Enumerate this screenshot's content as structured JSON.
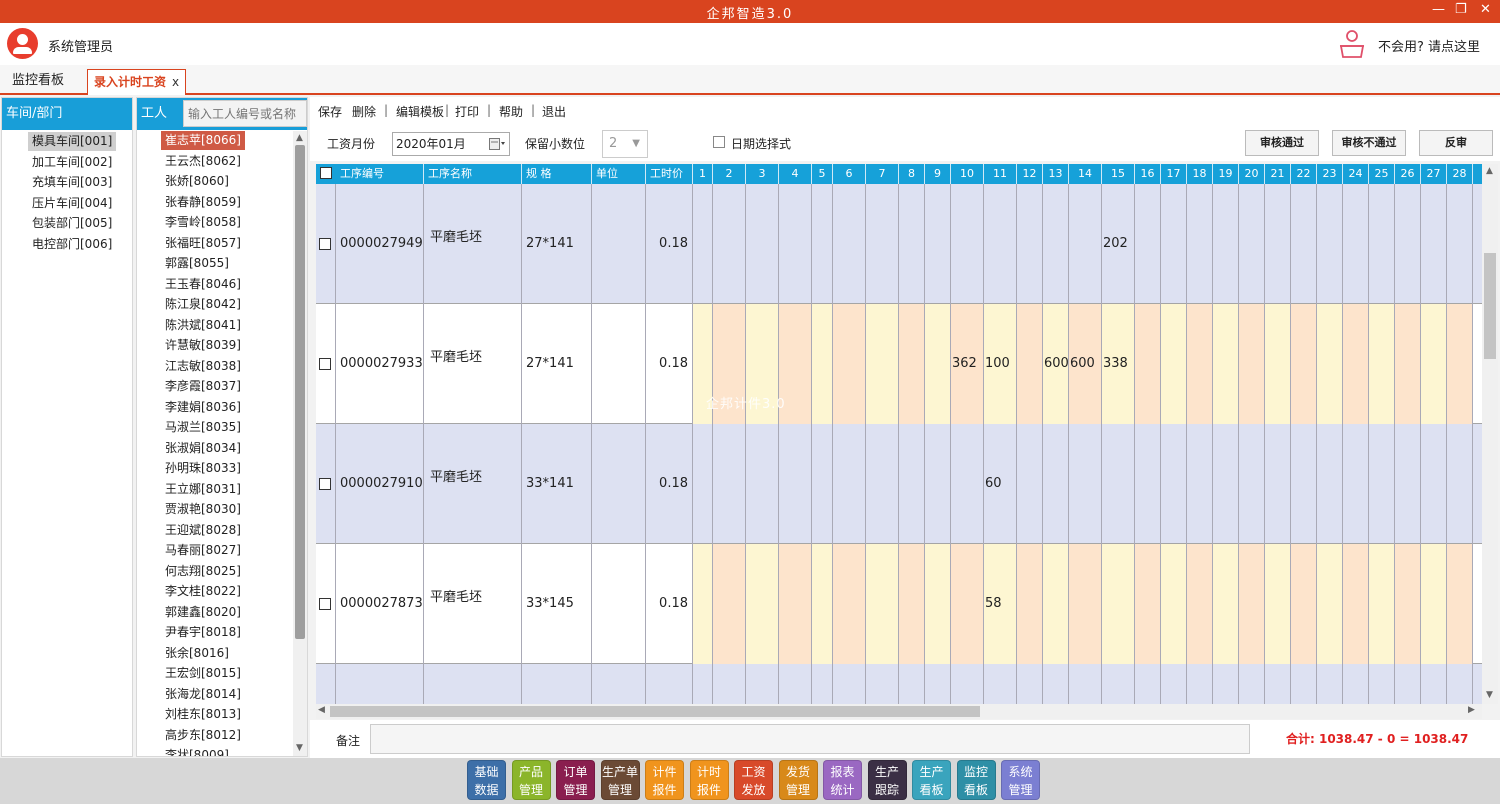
{
  "app": {
    "title": "企邦智造3.0"
  },
  "user": {
    "name": "系统管理员",
    "help_text": "不会用? 请点这里"
  },
  "tabs": [
    {
      "label": "监控看板"
    },
    {
      "label": "录入计时工资",
      "close": "x"
    }
  ],
  "departments": {
    "header": "车间/部门",
    "items": [
      "模具车间[001]",
      "加工车间[002]",
      "充填车间[003]",
      "压片车间[004]",
      "包装部门[005]",
      "电控部门[006]"
    ]
  },
  "workers": {
    "header": "工人",
    "search_placeholder": "输入工人编号或名称",
    "items": [
      "崔志苹[8066]",
      "王云杰[8062]",
      "张娇[8060]",
      "张春静[8059]",
      "李雪岭[8058]",
      "张福旺[8057]",
      "郭露[8055]",
      "王玉春[8046]",
      "陈江泉[8042]",
      "陈洪斌[8041]",
      "许慧敏[8039]",
      "江志敏[8038]",
      "李彦霞[8037]",
      "李建娟[8036]",
      "马淑兰[8035]",
      "张淑娟[8034]",
      "孙明珠[8033]",
      "王立娜[8031]",
      "贾淑艳[8030]",
      "王迎斌[8028]",
      "马春丽[8027]",
      "何志翔[8025]",
      "李文桂[8022]",
      "郭建鑫[8020]",
      "尹春宇[8018]",
      "张余[8016]",
      "王宏剑[8015]",
      "张海龙[8014]",
      "刘桂东[8013]",
      "高步东[8012]",
      "李状[8009]"
    ]
  },
  "toolbar": [
    "保存",
    "删除",
    "编辑模板",
    "打印",
    "帮助",
    "退出"
  ],
  "toolbar_sep": "|",
  "filters": {
    "month_label": "工资月份",
    "month_value": "2020年01月",
    "decimal_label": "保留小数位",
    "decimal_value": "2",
    "date_select_label": "日期选择式"
  },
  "actions": {
    "approve": "审核通过",
    "reject": "审核不通过",
    "unapprove": "反审"
  },
  "grid": {
    "columns": {
      "code": "工序编号",
      "name": "工序名称",
      "spec": "规  格",
      "unit": "单位",
      "rate": "工时价"
    },
    "days": [
      "1",
      "2",
      "3",
      "4",
      "5",
      "6",
      "7",
      "8",
      "9",
      "10",
      "11",
      "12",
      "13",
      "14",
      "15",
      "16",
      "17",
      "18",
      "19",
      "20",
      "21",
      "22",
      "23",
      "24",
      "25",
      "26",
      "27",
      "28"
    ],
    "rows": [
      {
        "code": "0000027949",
        "name": "平磨毛坯",
        "spec": "27*141",
        "unit": "",
        "rate": "0.18",
        "days": {
          "15": "202"
        }
      },
      {
        "code": "0000027933",
        "name": "平磨毛坯",
        "spec": "27*141",
        "unit": "",
        "rate": "0.18",
        "days": {
          "10": "362",
          "11": "100",
          "13": "600",
          "14": "600",
          "15": "338"
        }
      },
      {
        "code": "0000027910",
        "name": "平磨毛坯",
        "spec": "33*141",
        "unit": "",
        "rate": "0.18",
        "days": {
          "11": "60"
        }
      },
      {
        "code": "0000027873",
        "name": "平磨毛坯",
        "spec": "33*145",
        "unit": "",
        "rate": "0.18",
        "days": {
          "11": "58"
        }
      },
      {
        "code": "",
        "name": "",
        "spec": "",
        "unit": "",
        "rate": "",
        "days": {}
      }
    ]
  },
  "watermark": "企邦计件3.0",
  "footer": {
    "remark_label": "备注",
    "total_text": "合计:    1038.47  -  0  =  1038.47"
  },
  "colors": {
    "accent": "#d9441f",
    "header_blue": "#16a1d9",
    "row_blue": "#dde1f2",
    "row_yellow": "#fdf6d2",
    "row_peach": "#fde4cc"
  },
  "bottom_nav": [
    {
      "line1": "基础",
      "line2": "数据",
      "color": "#3d6fa8"
    },
    {
      "line1": "产品",
      "line2": "管理",
      "color": "#8bb52a"
    },
    {
      "line1": "订单",
      "line2": "管理",
      "color": "#8a1e4f"
    },
    {
      "line1": "生产单",
      "line2": "管理",
      "color": "#6b4a35"
    },
    {
      "line1": "计件",
      "line2": "报件",
      "color": "#f0941d"
    },
    {
      "line1": "计时",
      "line2": "报件",
      "color": "#f0941d"
    },
    {
      "line1": "工资",
      "line2": "发放",
      "color": "#d84a2a"
    },
    {
      "line1": "发货",
      "line2": "管理",
      "color": "#d8891a"
    },
    {
      "line1": "报表",
      "line2": "统计",
      "color": "#9a68c2"
    },
    {
      "line1": "生产",
      "line2": "跟踪",
      "color": "#3b2f45"
    },
    {
      "line1": "生产",
      "line2": "看板",
      "color": "#3aa4bd"
    },
    {
      "line1": "监控",
      "line2": "看板",
      "color": "#2e8fa6"
    },
    {
      "line1": "系统",
      "line2": "管理",
      "color": "#7b7fd2"
    }
  ]
}
